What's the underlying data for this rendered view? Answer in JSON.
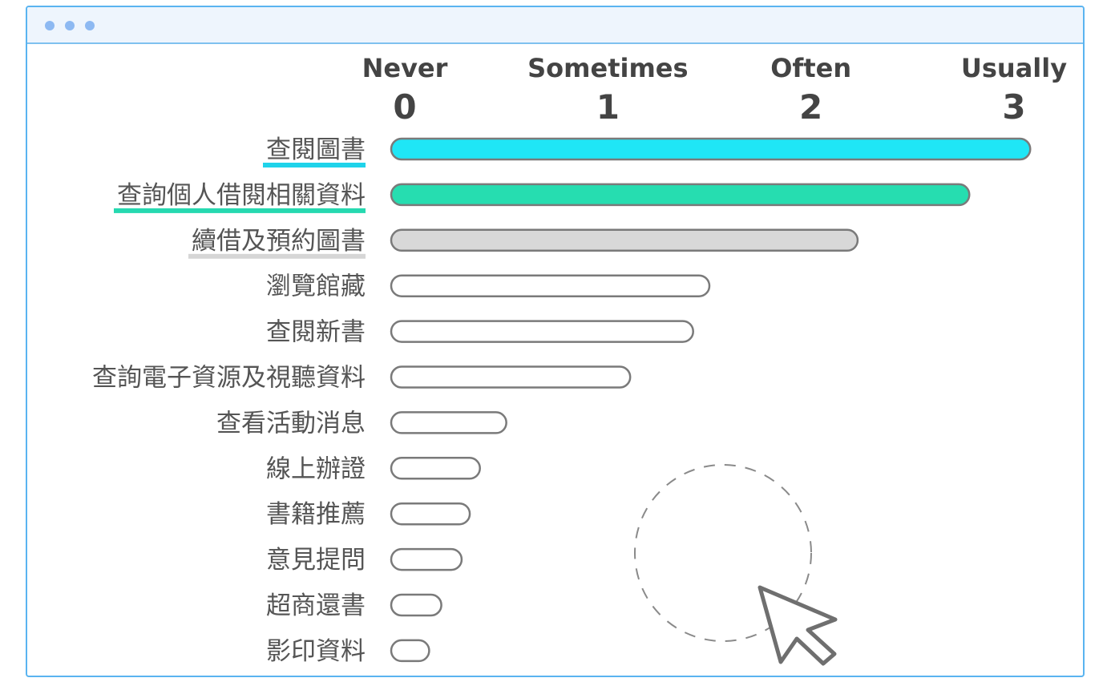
{
  "chart_data": {
    "type": "bar",
    "orientation": "horizontal",
    "x_axis": {
      "ticks": [
        {
          "value": 0,
          "word": "Never",
          "label": "0"
        },
        {
          "value": 1,
          "word": "Sometimes",
          "label": "1"
        },
        {
          "value": 2,
          "word": "Often",
          "label": "2"
        },
        {
          "value": 3,
          "word": "Usually",
          "label": "3"
        }
      ],
      "range": [
        0,
        3
      ],
      "position": "top"
    },
    "categories": [
      "查閱圖書",
      "查詢個人借閱相關資料",
      "續借及預約圖書",
      "瀏覽館藏",
      "查閱新書",
      "查詢電子資源及視聽資料",
      "查看活動消息",
      "線上辦證",
      "書籍推薦",
      "意見提問",
      "超商還書",
      "影印資料"
    ],
    "values": [
      3.08,
      2.78,
      2.23,
      1.5,
      1.42,
      1.11,
      0.5,
      0.37,
      0.32,
      0.28,
      0.18,
      0.12
    ],
    "colors": [
      "#1fe6f6",
      "#26ddb0",
      "#d8d8d8",
      "#ffffff",
      "#ffffff",
      "#ffffff",
      "#ffffff",
      "#ffffff",
      "#ffffff",
      "#ffffff",
      "#ffffff",
      "#ffffff"
    ],
    "highlight_colors": [
      "#1fd3ea",
      "#26d9b0",
      "#d6d6d6",
      "",
      "",
      "",
      "",
      "",
      "",
      "",
      "",
      ""
    ],
    "bar_outline_color": "#7a7a7a",
    "grid": false,
    "legend": "none"
  },
  "window": {
    "border_color": "#5ab4f0",
    "titlebar_color": "#eef5fd",
    "dot_color": "#8db9f2"
  },
  "decoration": {
    "icons": [
      "dashed-circle-icon",
      "cursor-arrow-icon"
    ]
  }
}
